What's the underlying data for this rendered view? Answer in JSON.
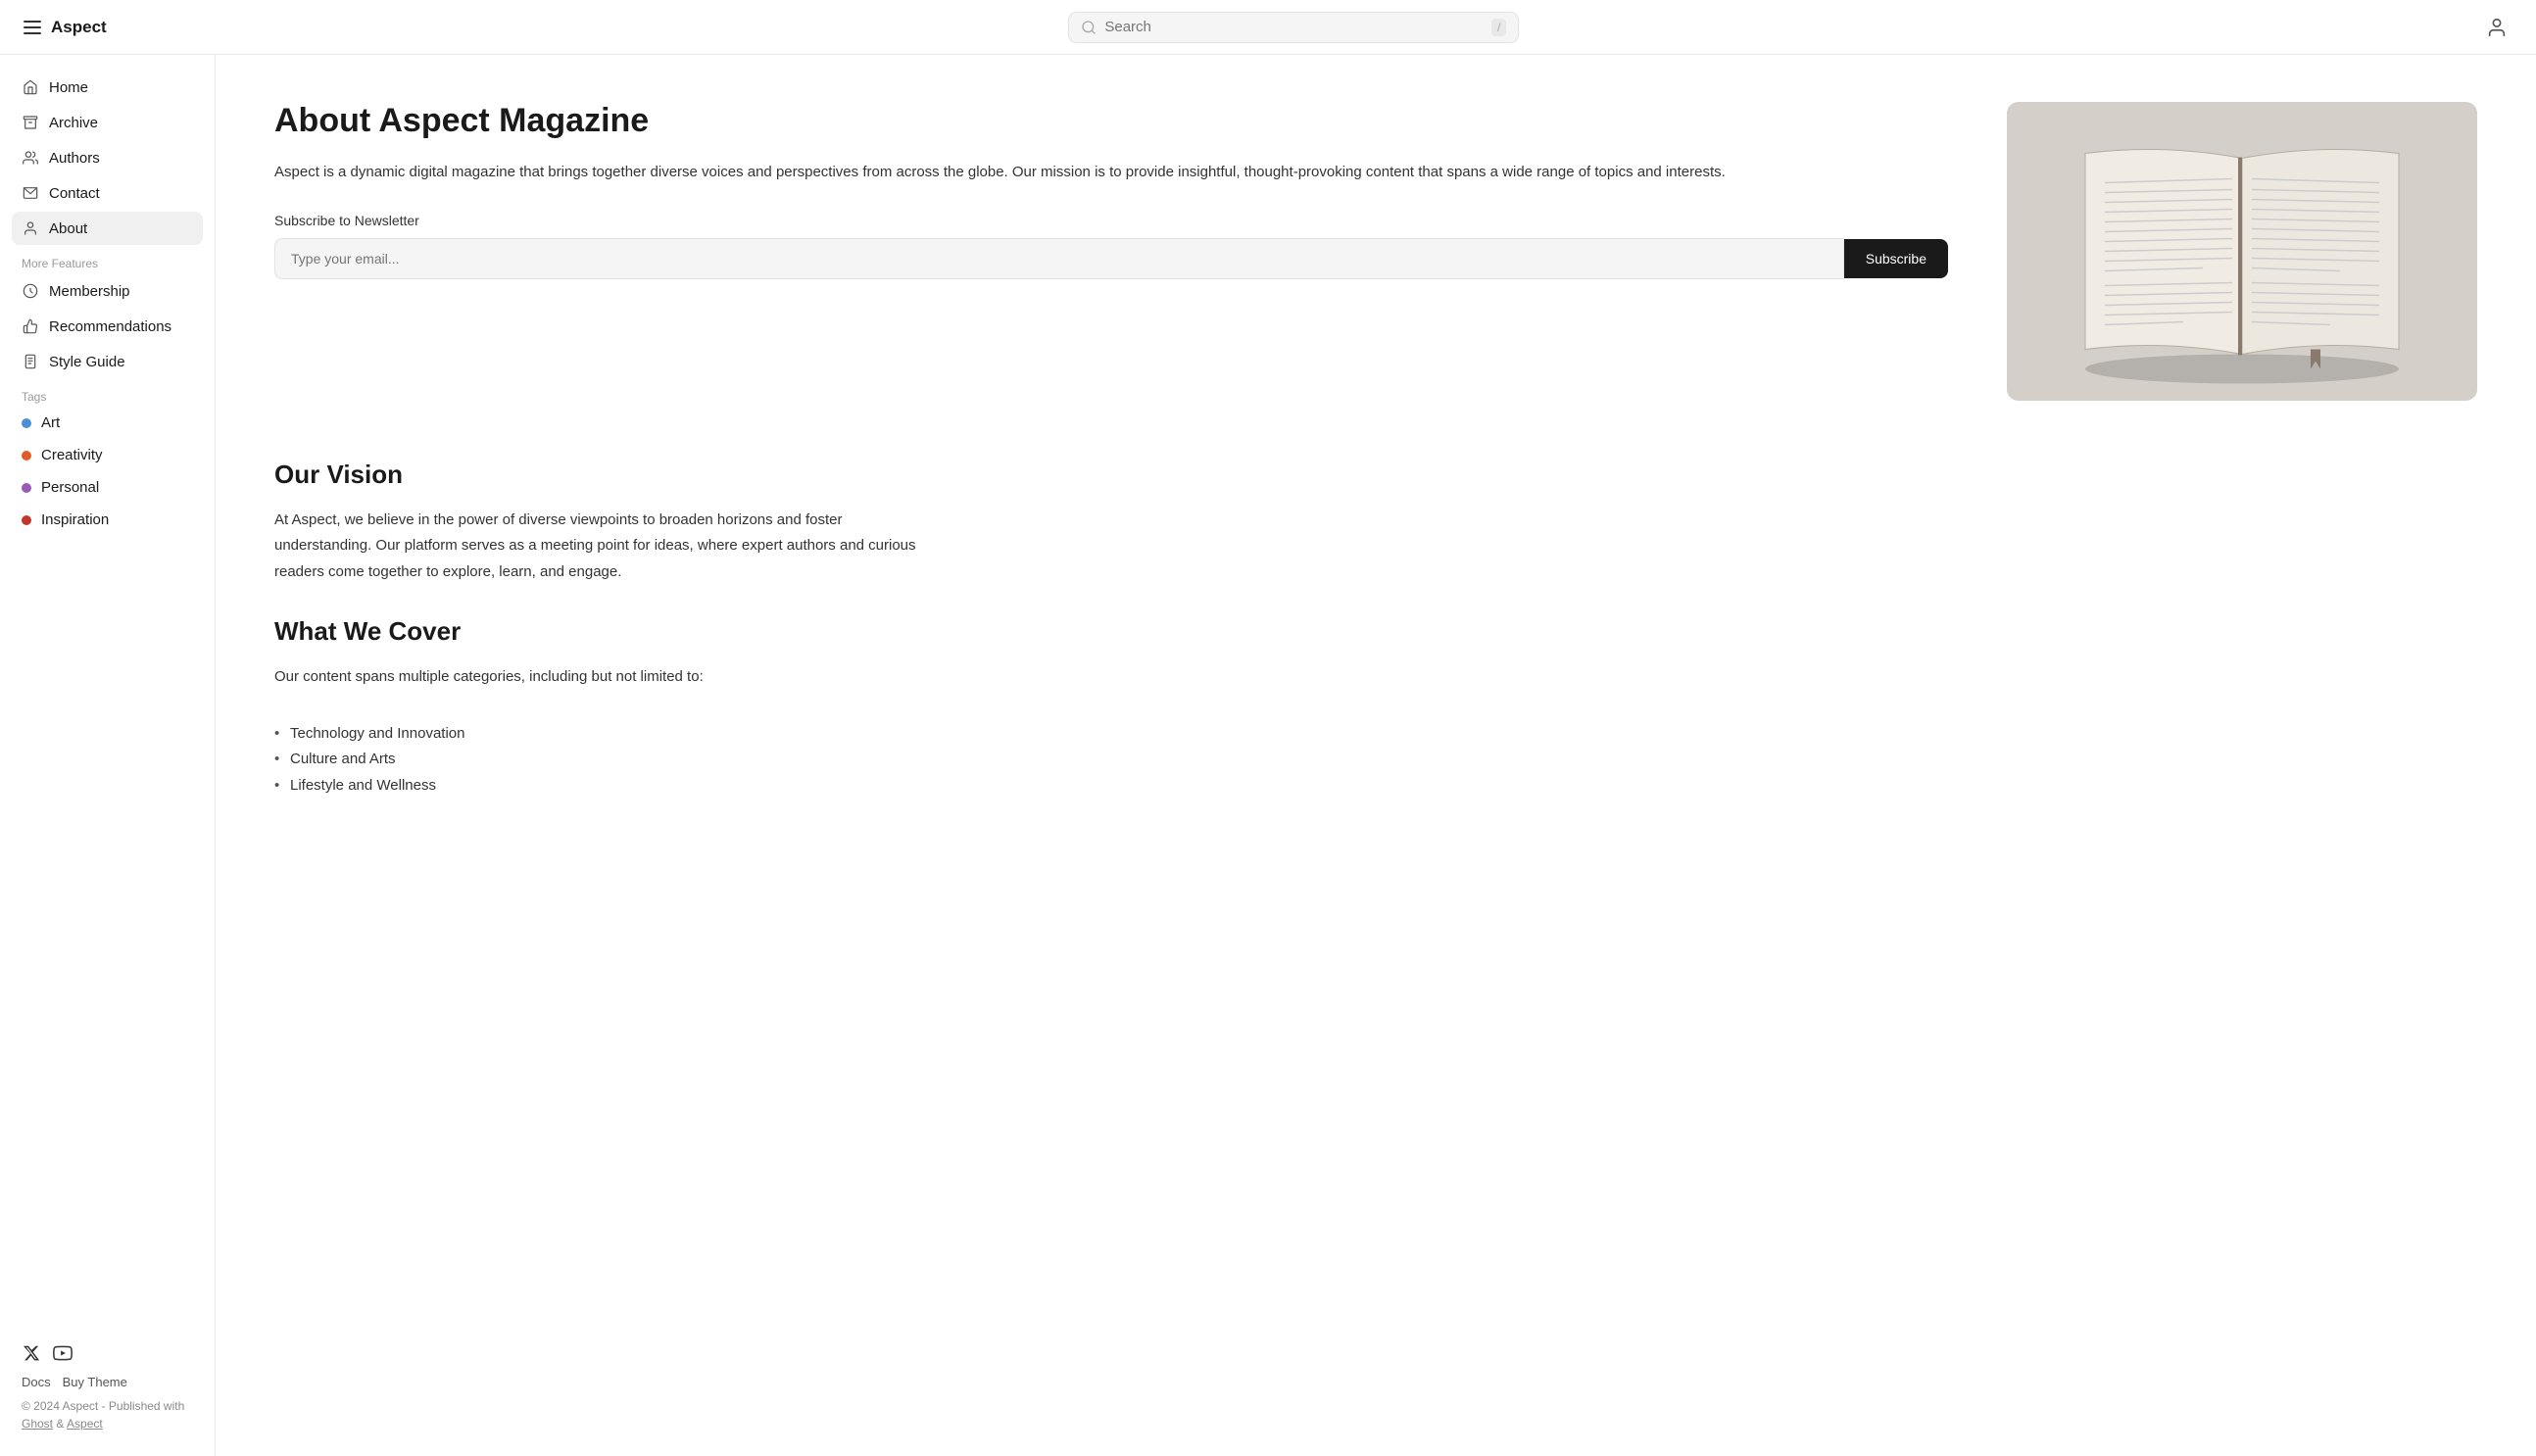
{
  "topbar": {
    "brand": "Aspect",
    "search_placeholder": "Search",
    "search_shortcut": "/"
  },
  "sidebar": {
    "nav_items": [
      {
        "id": "home",
        "label": "Home",
        "icon": "home-icon",
        "active": false
      },
      {
        "id": "archive",
        "label": "Archive",
        "icon": "archive-icon",
        "active": false
      },
      {
        "id": "authors",
        "label": "Authors",
        "icon": "authors-icon",
        "active": false
      },
      {
        "id": "contact",
        "label": "Contact",
        "icon": "contact-icon",
        "active": false
      },
      {
        "id": "about",
        "label": "About",
        "icon": "about-icon",
        "active": true
      }
    ],
    "more_features_label": "More Features",
    "more_items": [
      {
        "id": "membership",
        "label": "Membership",
        "icon": "membership-icon"
      },
      {
        "id": "recommendations",
        "label": "Recommendations",
        "icon": "recommendations-icon"
      },
      {
        "id": "style-guide",
        "label": "Style Guide",
        "icon": "style-guide-icon"
      }
    ],
    "tags_label": "Tags",
    "tags": [
      {
        "id": "art",
        "label": "Art",
        "color": "#4a90d9"
      },
      {
        "id": "creativity",
        "label": "Creativity",
        "color": "#e05c2a"
      },
      {
        "id": "personal",
        "label": "Personal",
        "color": "#9b59b6"
      },
      {
        "id": "inspiration",
        "label": "Inspiration",
        "color": "#c0392b"
      }
    ],
    "footer": {
      "docs_label": "Docs",
      "buy_theme_label": "Buy Theme",
      "copyright": "© 2024 Aspect - Published with",
      "ghost_label": "Ghost",
      "and_label": "&",
      "aspect_label": "Aspect"
    }
  },
  "main": {
    "title": "About Aspect Magazine",
    "description": "Aspect is a dynamic digital magazine that brings together diverse voices and perspectives from across the globe. Our mission is to provide insightful, thought-provoking content that spans a wide range of topics and interests.",
    "newsletter": {
      "label": "Subscribe to Newsletter",
      "placeholder": "Type your email...",
      "button_label": "Subscribe"
    },
    "vision": {
      "title": "Our Vision",
      "text": "At Aspect, we believe in the power of diverse viewpoints to broaden horizons and foster understanding. Our platform serves as a meeting point for ideas, where expert authors and curious readers come together to explore, learn, and engage."
    },
    "what_we_cover": {
      "title": "What We Cover",
      "intro": "Our content spans multiple categories, including but not limited to:",
      "items": [
        "Technology and Innovation",
        "Culture and Arts",
        "Lifestyle and Wellness"
      ]
    }
  }
}
